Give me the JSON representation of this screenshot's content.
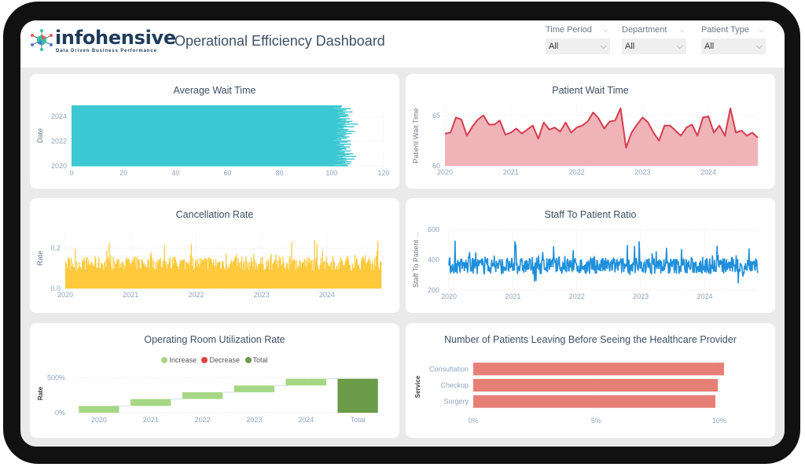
{
  "header": {
    "logo_word": "infohensive",
    "logo_tagline": "Data Driven Business Performance",
    "title": "Operational Efficiency Dashboard"
  },
  "filters": [
    {
      "label": "Time Period",
      "value": "All"
    },
    {
      "label": "Department",
      "value": "All"
    },
    {
      "label": "Patient Type",
      "value": "All"
    }
  ],
  "icons": {
    "chevron": "⌵"
  },
  "colors": {
    "teal": "#3cc8d2",
    "red_line": "#d63c4e",
    "red_fill": "#f0b4b8",
    "yellow": "#ffc93c",
    "blue": "#1f8fdb",
    "increase": "#a6d785",
    "decrease": "#e0413f",
    "total": "#6a9c4a",
    "salmon": "#e67f76"
  },
  "chart_data": [
    {
      "id": "avg_wait",
      "type": "bar",
      "orientation": "horizontal",
      "title": "Average Wait Time",
      "xlabel": "",
      "ylabel": "Date",
      "xlim": [
        0,
        120
      ],
      "xticks": [
        "0",
        "20",
        "40",
        "60",
        "80",
        "100",
        "120"
      ],
      "yticks": [
        "2020",
        "2022",
        "2024"
      ],
      "ylim": [
        2020,
        2024.9
      ],
      "note": "Dense daily bars 2020–2024, values approx 100–110",
      "values_sample": [
        105,
        103,
        104,
        101,
        107,
        102,
        106,
        104,
        103,
        108,
        102,
        105,
        104,
        107,
        103,
        106,
        105,
        104,
        102,
        107,
        103,
        105,
        104,
        108,
        106,
        102,
        105,
        110,
        104,
        103,
        106,
        109,
        104,
        105,
        103,
        107,
        106,
        104,
        108,
        102,
        105,
        107,
        103,
        106,
        104,
        105,
        107,
        103
      ]
    },
    {
      "id": "patient_wait",
      "type": "area",
      "title": "Patient Wait Time",
      "xlabel": "",
      "ylabel": "Patient Wait Time",
      "ylim": [
        60,
        66
      ],
      "yticks": [
        "60",
        "65"
      ],
      "xticks": [
        "2020",
        "2021",
        "2022",
        "2023",
        "2024"
      ],
      "xlim": [
        2020,
        2024.75
      ],
      "values": [
        63.2,
        63.3,
        64.8,
        64.6,
        63.0,
        63.9,
        64.6,
        65.0,
        64.1,
        64.1,
        64.5,
        63.1,
        63.3,
        63.7,
        63.2,
        63.6,
        64.0,
        62.7,
        64.3,
        63.6,
        63.8,
        63.4,
        64.3,
        63.3,
        63.8,
        64.0,
        64.4,
        65.3,
        64.7,
        63.7,
        64.4,
        64.5,
        65.7,
        61.8,
        63.3,
        64.1,
        64.8,
        64.3,
        63.3,
        62.5,
        64.0,
        64.0,
        63.5,
        63.0,
        63.8,
        64.1,
        63.0,
        64.8,
        64.9,
        63.3,
        64.0,
        63.0,
        65.7,
        63.3,
        63.5,
        63.0,
        63.3,
        62.8
      ]
    },
    {
      "id": "cancellation",
      "type": "bar",
      "title": "Cancellation Rate",
      "xlabel": "",
      "ylabel": "Rate",
      "ylim": [
        0,
        0.3
      ],
      "yticks": [
        "0.0",
        "0.2"
      ],
      "xticks": [
        "2020",
        "2021",
        "2022",
        "2023",
        "2024"
      ],
      "xlim": [
        2020,
        2024.83
      ],
      "note": "Dense daily bars, values approx 0.08–0.27, typical ~0.13"
    },
    {
      "id": "staff_ratio",
      "type": "line",
      "title": "Staff To Patient Ratio",
      "xlabel": "",
      "ylabel": "Staff To Patient ...",
      "ylim": [
        200,
        600
      ],
      "yticks": [
        "200",
        "400",
        "600"
      ],
      "xticks": [
        "2020",
        "2021",
        "2022",
        "2023",
        "2024"
      ],
      "xlim": [
        2020,
        2024.83
      ],
      "note": "Dense daily series oscillating approx 270–510, centered ~360"
    },
    {
      "id": "or_util",
      "type": "bar",
      "subtype": "waterfall",
      "title": "Operating Room Utilization Rate",
      "ylabel": "Rate",
      "yticks": [
        "0%",
        "500%"
      ],
      "ylim": [
        0,
        550
      ],
      "legend": [
        "Increase",
        "Decrease",
        "Total"
      ],
      "legend_position": "top-center",
      "categories": [
        "2020",
        "2021",
        "2022",
        "2023",
        "2024",
        "Total"
      ],
      "increments": [
        98,
        98,
        97,
        96,
        97
      ],
      "total": 486
    },
    {
      "id": "patients_leaving",
      "type": "bar",
      "orientation": "horizontal",
      "title": "Number of Patients Leaving Before Seeing the Healthcare Provider",
      "ylabel": "Service",
      "xticks": [
        "0%",
        "5%",
        "10%"
      ],
      "xlim": [
        0,
        11
      ],
      "categories": [
        "Consultation",
        "Checkup",
        "Surgery"
      ],
      "values": [
        10.2,
        9.95,
        9.85
      ]
    }
  ]
}
